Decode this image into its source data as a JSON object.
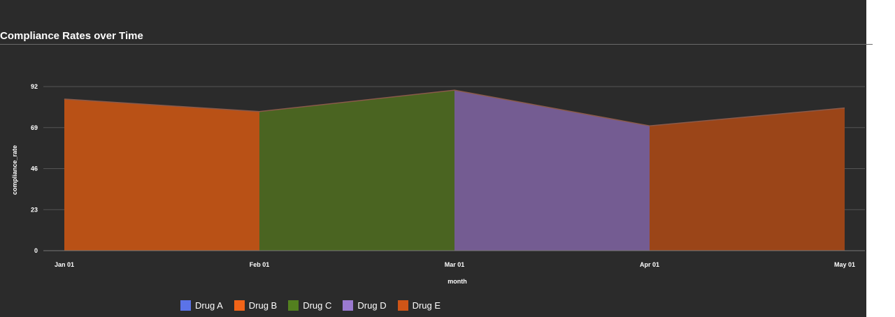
{
  "chart_data": {
    "type": "area",
    "title": "Compliance Rates over Time",
    "xlabel": "month",
    "ylabel": "compliance_rate",
    "categories": [
      "Jan 01",
      "Feb 01",
      "Mar 01",
      "Apr 01",
      "May 01"
    ],
    "yticks": [
      0,
      23,
      46,
      69,
      92
    ],
    "ylim": [
      0,
      92
    ],
    "grid": true,
    "legend_position": "bottom",
    "series": [
      {
        "name": "Drug A",
        "color": "#5b73e8",
        "fill": "#4d62bd",
        "values": [
          85,
          0,
          null,
          null,
          null
        ]
      },
      {
        "name": "Drug B",
        "color": "#f26418",
        "fill": "#b95116",
        "values": [
          85,
          78,
          0,
          null,
          null
        ]
      },
      {
        "name": "Drug C",
        "color": "#53801f",
        "fill": "#4a6421",
        "values": [
          null,
          78,
          90,
          0,
          null
        ]
      },
      {
        "name": "Drug D",
        "color": "#9a79d0",
        "fill": "#745c92",
        "values": [
          null,
          null,
          90,
          70,
          0
        ]
      },
      {
        "name": "Drug E",
        "color": "#cf5517",
        "fill": "#9b4518",
        "values": [
          null,
          null,
          null,
          70,
          80
        ]
      }
    ]
  }
}
